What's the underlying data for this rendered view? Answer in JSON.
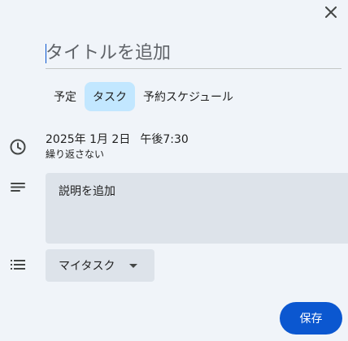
{
  "dialog": {
    "close_icon": "close-icon",
    "title_placeholder": "タイトルを追加",
    "tabs": [
      {
        "label": "予定",
        "active": false
      },
      {
        "label": "タスク",
        "active": true
      },
      {
        "label": "予約スケジュール",
        "active": false
      }
    ],
    "datetime": {
      "icon": "clock-icon",
      "date": "2025年 1月 2日",
      "time": "午後7:30",
      "repeat": "繰り返さない"
    },
    "description": {
      "icon": "notes-icon",
      "placeholder": "説明を追加"
    },
    "task_list": {
      "icon": "list-icon",
      "selected": "マイタスク"
    },
    "save_label": "保存",
    "colors": {
      "background": "#f0f4f9",
      "field": "#dde3ea",
      "active_tab": "#c2e7ff",
      "primary": "#0b57d0"
    }
  }
}
